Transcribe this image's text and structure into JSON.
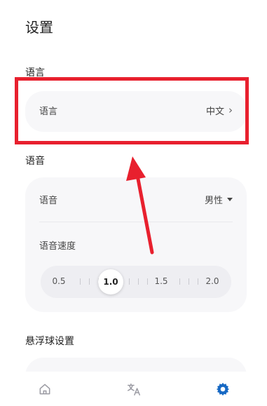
{
  "header": {
    "title": "设置"
  },
  "language_section": {
    "title": "语言",
    "row_label": "语言",
    "row_value": "中文",
    "chevron_icon": "chevron-right-icon"
  },
  "voice_section": {
    "title": "语音",
    "voice_label": "语音",
    "voice_value": "男性",
    "speed_label": "语音速度",
    "speed_options": [
      "0.5",
      "1.0",
      "1.5",
      "2.0"
    ],
    "speed_selected": "1.0"
  },
  "floating_section": {
    "title": "悬浮球设置"
  },
  "tabs": [
    {
      "name": "home",
      "icon": "home-icon"
    },
    {
      "name": "translate",
      "icon": "translate-icon"
    },
    {
      "name": "settings",
      "icon": "gear-icon",
      "active": true
    }
  ],
  "colors": {
    "accent": "#1769c4",
    "highlight": "#e8202e",
    "card": "#f7f7f9"
  }
}
